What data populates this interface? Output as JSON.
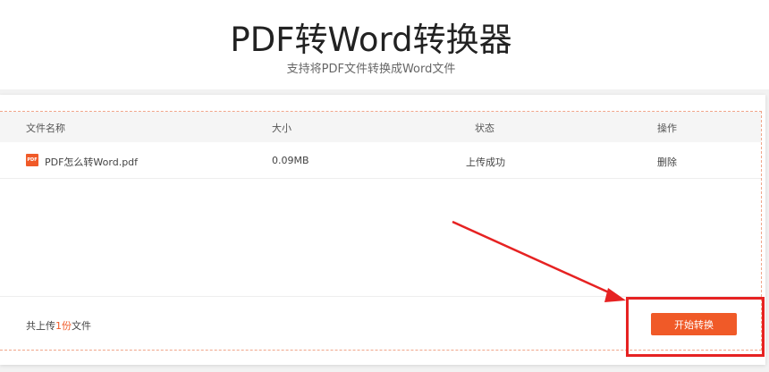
{
  "hero": {
    "title": "PDF转Word转换器",
    "subtitle": "支持将PDF文件转换成Word文件"
  },
  "table": {
    "headers": {
      "name": "文件名称",
      "size": "大小",
      "status": "状态",
      "action": "操作"
    },
    "rows": [
      {
        "icon": "pdf-file-icon",
        "icon_label": "PDF",
        "name": "PDF怎么转Word.pdf",
        "size": "0.09MB",
        "status": "上传成功",
        "action": "删除"
      }
    ]
  },
  "footer": {
    "summary_prefix": "共上传",
    "count": "1份",
    "summary_suffix": "文件",
    "start_button": "开始转换"
  },
  "colors": {
    "accent": "#f05a28",
    "annotation": "#e62222",
    "dashed_border": "#f0a58a"
  }
}
